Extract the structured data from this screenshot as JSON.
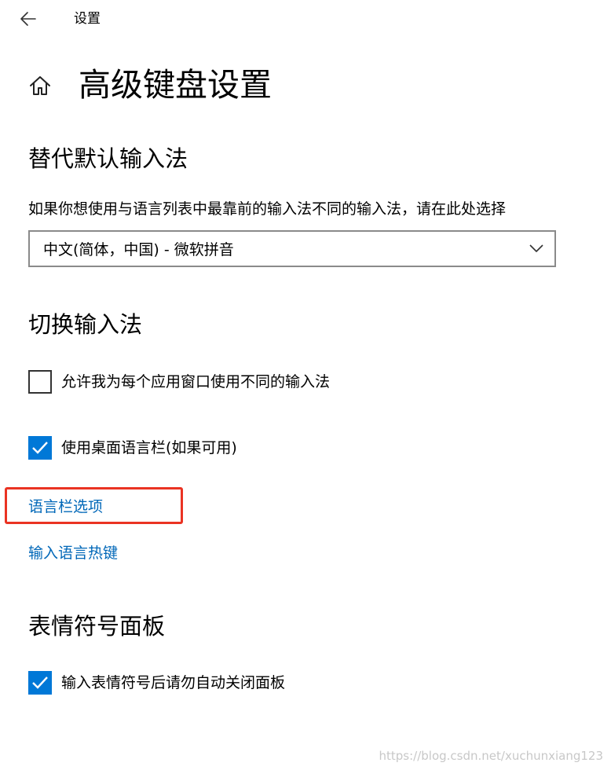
{
  "window": {
    "title": "设置"
  },
  "header": {
    "title": "高级键盘设置"
  },
  "default_input": {
    "heading": "替代默认输入法",
    "description": "如果你想使用与语言列表中最靠前的输入法不同的输入法，请在此处选择",
    "dropdown_value": "中文(简体，中国) - 微软拼音"
  },
  "switch_input": {
    "heading": "切换输入法",
    "options": [
      {
        "label": "允许我为每个应用窗口使用不同的输入法",
        "checked": false
      },
      {
        "label": "使用桌面语言栏(如果可用)",
        "checked": true
      }
    ],
    "links": [
      "语言栏选项",
      "输入语言热键"
    ]
  },
  "emoji_panel": {
    "heading": "表情符号面板",
    "options": [
      {
        "label": "输入表情符号后请勿自动关闭面板",
        "checked": true
      }
    ]
  },
  "watermark": "https://blog.csdn.net/xuchunxiang123",
  "colors": {
    "accent": "#0078d7",
    "link": "#0067b8",
    "highlight": "#ea3323"
  },
  "icons": {
    "back": "arrow-left",
    "home": "home",
    "dropdown": "chevron-down",
    "check": "checkmark"
  }
}
